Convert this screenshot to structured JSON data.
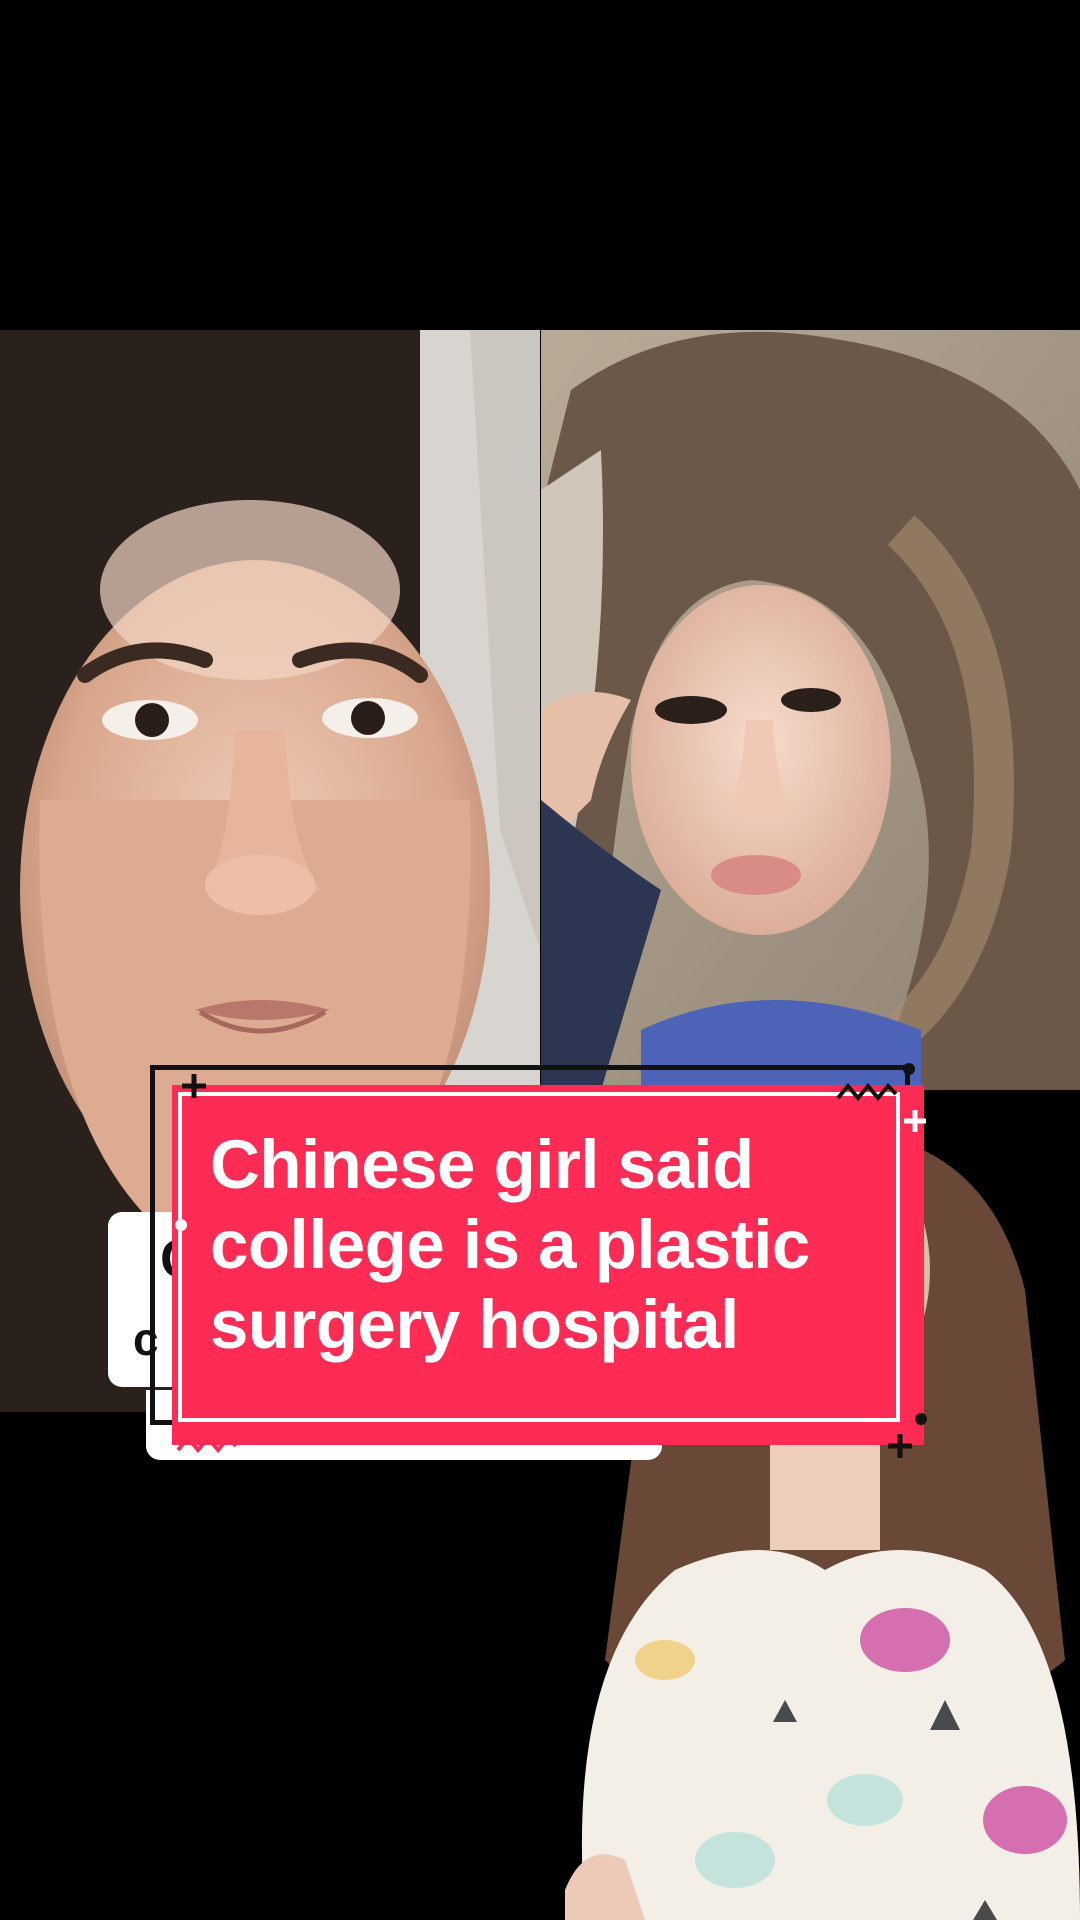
{
  "overlay": {
    "title": "Chinese girl said college is a plastic surgery hospital",
    "peek_text_1": "C",
    "peek_text_2": "c"
  },
  "colors": {
    "background": "#000000",
    "title_card": "#fe2c55",
    "title_text": "#ffffff",
    "outline": "#111111"
  },
  "icons": {
    "plus_marks": "plus-icon",
    "zigzag": "zigzag-icon",
    "dot": "dot-icon"
  }
}
